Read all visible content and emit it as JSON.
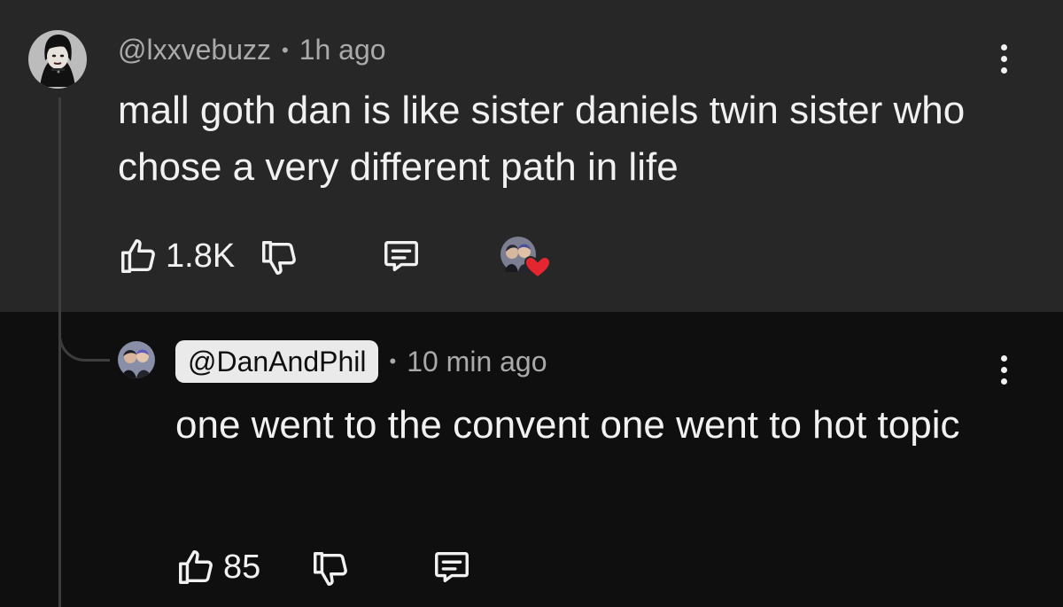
{
  "parent_comment": {
    "handle": "@lxxvebuzz",
    "time": "1h ago",
    "separator": "•",
    "text": "mall goth dan is like sister daniels twin sister who chose a very different path in life",
    "like_count": "1.8K",
    "icons": {
      "like": "thumbs-up-icon",
      "dislike": "thumbs-down-icon",
      "reply": "reply-comment-icon",
      "more": "more-vertical-icon",
      "creator_heart": "red-heart-icon"
    }
  },
  "reply_comment": {
    "handle": "@DanAndPhil",
    "time": "10 min ago",
    "separator": "•",
    "text": "one went to the convent one went to hot topic",
    "like_count": "85",
    "icons": {
      "like": "thumbs-up-icon",
      "dislike": "thumbs-down-icon",
      "reply": "reply-comment-icon",
      "more": "more-vertical-icon"
    }
  },
  "colors": {
    "parent_background": "#272727",
    "reply_background": "#0f0f0f",
    "primary_text": "#f1f1f1",
    "secondary_text": "#aaaaaa",
    "handle_pill": "#eaeaea",
    "heart": "#e3262f"
  }
}
